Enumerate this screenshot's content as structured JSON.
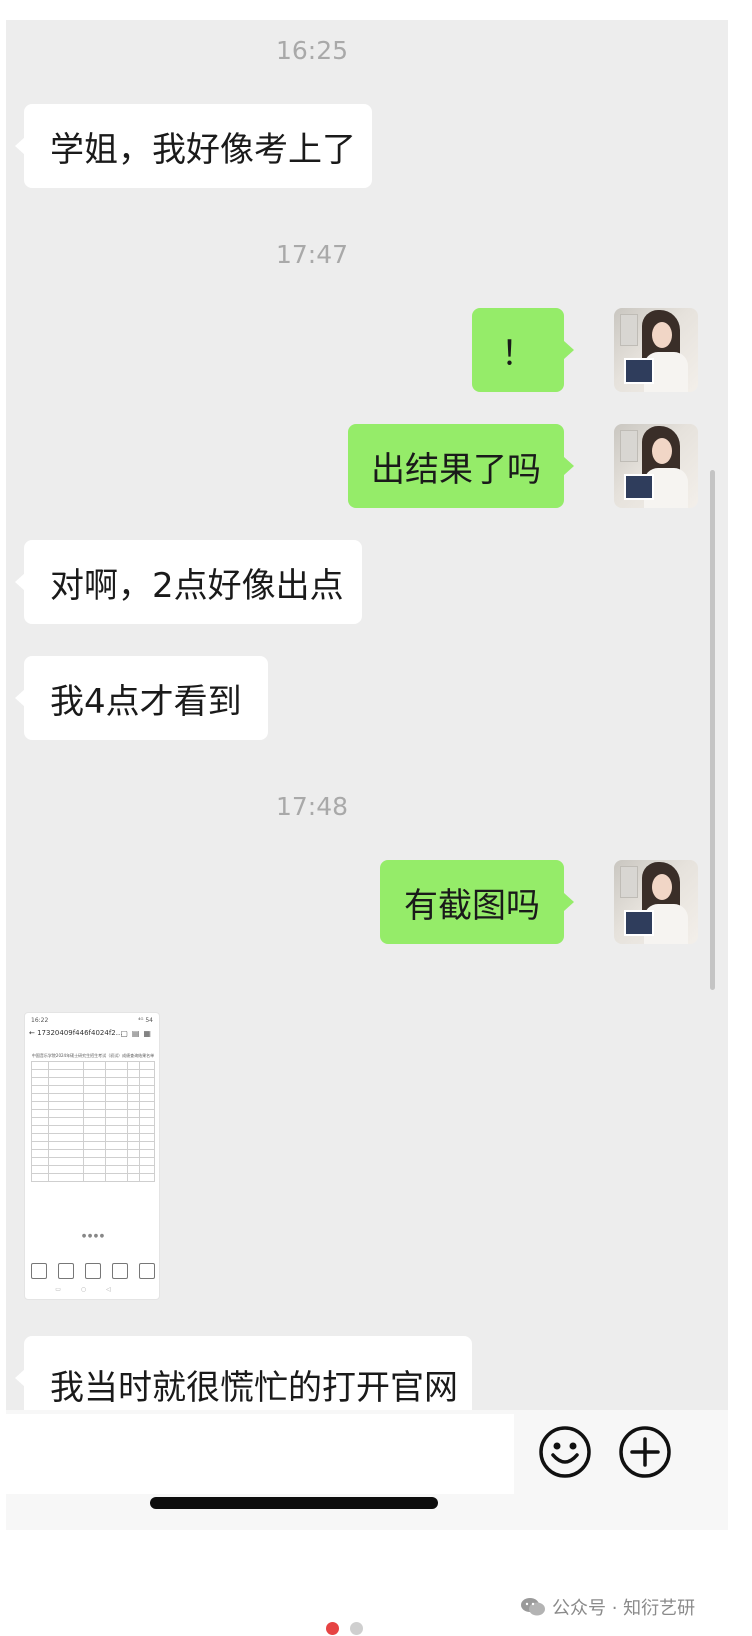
{
  "messages": {
    "ts1": "16:25",
    "msg1": "学姐，我好像考上了",
    "ts2": "17:47",
    "msg2": "！",
    "msg3": "出结果了吗",
    "msg4": "对啊，2点好像出点",
    "msg5": "我4点才看到",
    "ts3": "17:48",
    "msg6": "有截图吗",
    "msg7": "我当时就很慌忙的打开官网"
  },
  "screenshot_image": {
    "status_time": "16:22",
    "status_right": "⁴ᴳ 54",
    "header_text": "17320409f446f4024f2...",
    "doc_title": "中国音乐学院2024年硕士研究生招生考试（初试）成绩查询结果名单",
    "pager": "● ● ● ●"
  },
  "watermark": "公众号 · 知衍艺研",
  "icons": {
    "emoji": "smiley-face",
    "plus": "circle-plus"
  },
  "colors": {
    "chat_bg": "#ededed",
    "outgoing_bubble": "#95ec69",
    "incoming_bubble": "#ffffff",
    "page_dot_active": "#e64343",
    "page_dot_inactive": "#cfcfcf"
  }
}
